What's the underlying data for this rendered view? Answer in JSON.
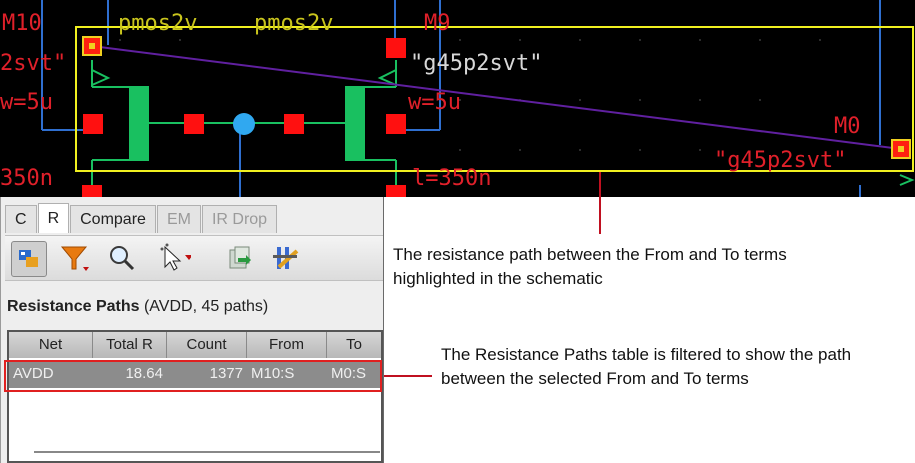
{
  "schematic": {
    "labels": {
      "m10": "M10",
      "m9": "M9",
      "m0": "M0",
      "pmos_a": "pmos2v",
      "pmos_b": "pmos2v",
      "model_left": "2svt\"",
      "model_mid": "\"g45p2svt\"",
      "model_right": "\"g45p2svt\"",
      "w_left": "w=5u",
      "w_mid": "w=5u",
      "l_left": "350n",
      "l_mid": "l=350n"
    },
    "colors": {
      "background": "#000000",
      "wire": "#2f6fd0",
      "device": "#19c060",
      "pin": "#ff1010",
      "highlight_box": "#f0f020",
      "path_line": "#6020a0",
      "node": "#30a8f0"
    }
  },
  "panel": {
    "tabs": [
      {
        "label": "C"
      },
      {
        "label": "R"
      },
      {
        "label": "Compare"
      },
      {
        "label": "EM"
      },
      {
        "label": "IR Drop"
      }
    ],
    "toolbar_icons": [
      "probe-icon",
      "filter-icon",
      "magnifier-icon",
      "select-pointer-icon",
      "export-icon",
      "settings-icon"
    ],
    "heading_bold": "Resistance Paths",
    "heading_rest": "(AVDD, 45 paths)",
    "table": {
      "columns": [
        "Net",
        "Total R",
        "Count",
        "From",
        "To"
      ],
      "rows": [
        {
          "net": "AVDD",
          "total_r": "18.64",
          "count": "1377",
          "from": "M10:S",
          "to": "M0:S"
        }
      ]
    }
  },
  "callouts": {
    "schematic_note": "The resistance path between the From and To terms highlighted in the schematic",
    "table_note": "The Resistance Paths table is filtered to show the path between the selected From and To terms"
  }
}
